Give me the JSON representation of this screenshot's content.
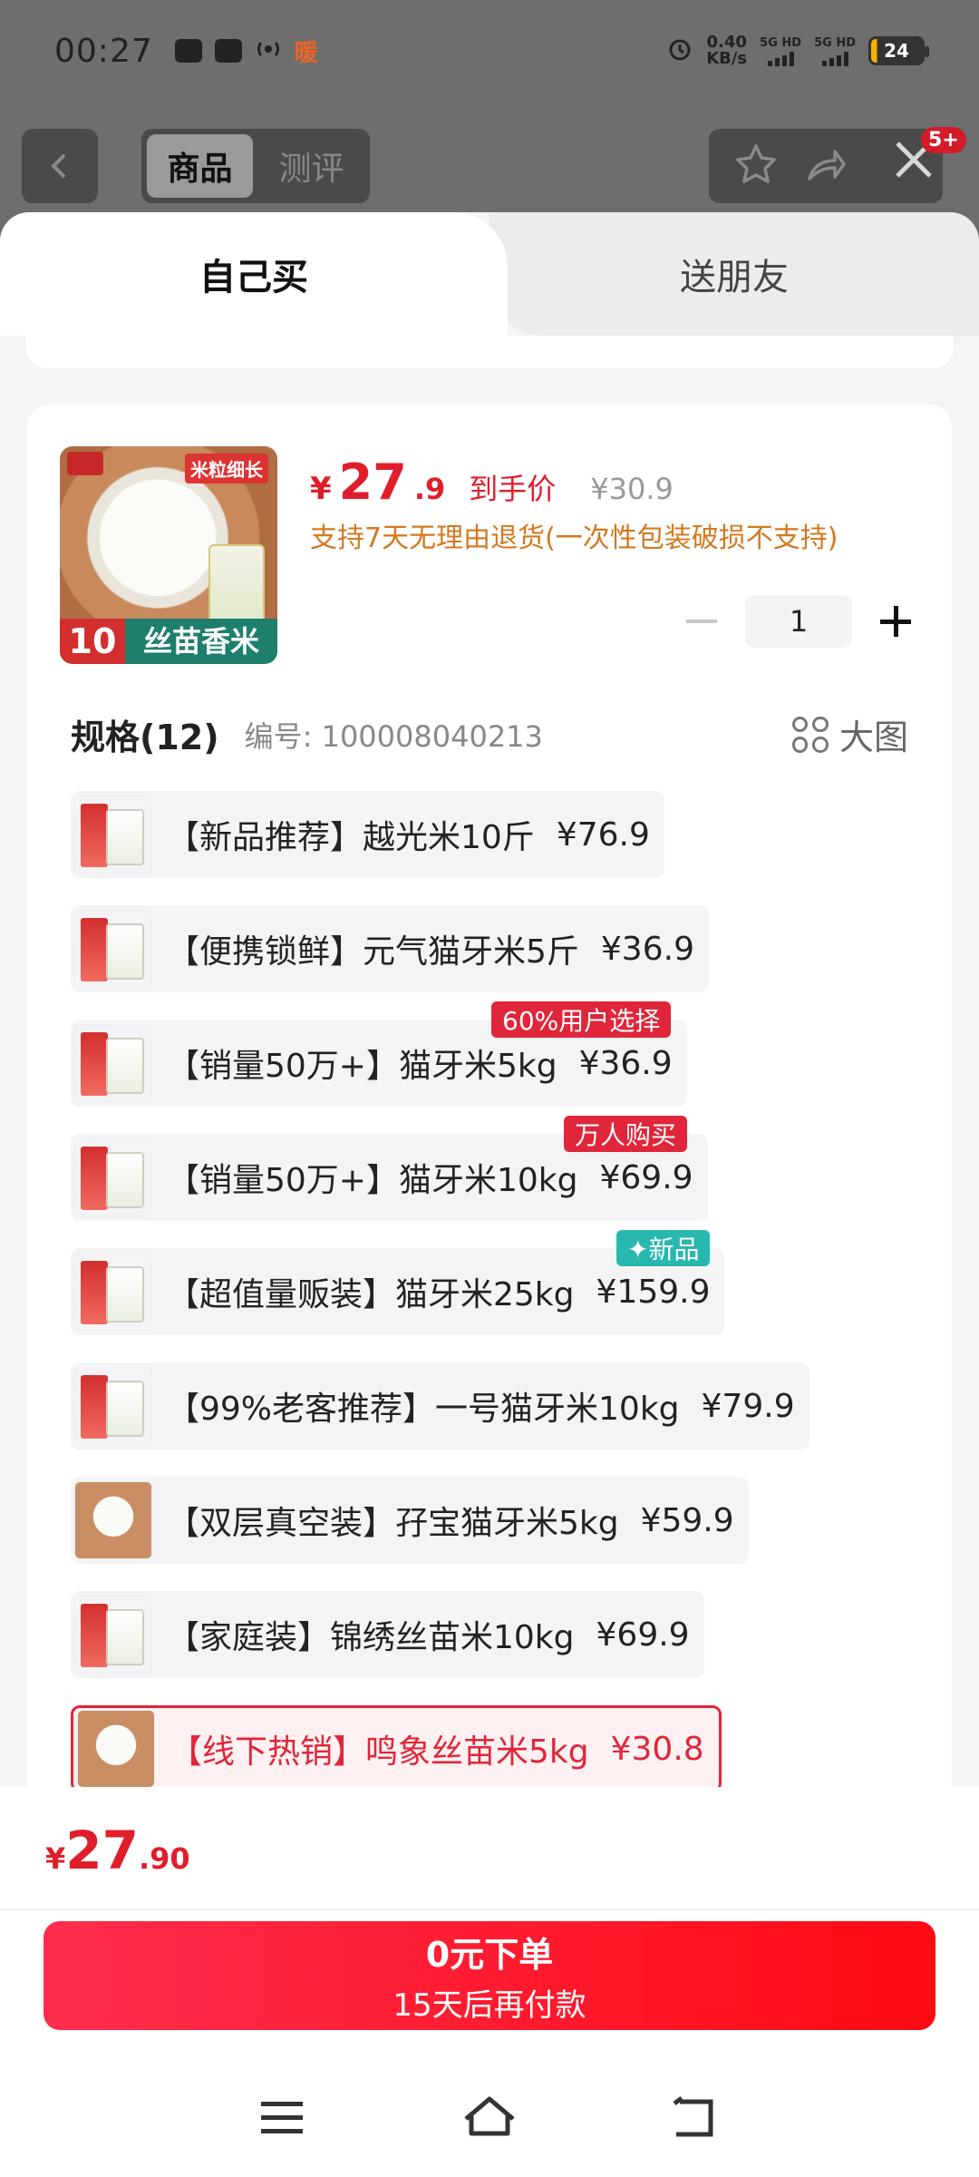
{
  "status_bar": {
    "time": "00:27",
    "indicator": "暖",
    "net_speed": "0.40",
    "net_unit": "KB/s",
    "signal1": "5G HD",
    "signal2": "5G HD",
    "battery": "24"
  },
  "top_nav": {
    "tab_product": "商品",
    "tab_review": "测评",
    "badge": "5+"
  },
  "purchase_tabs": {
    "self": "自己买",
    "gift": "送朋友"
  },
  "product": {
    "image_tag": "米粒细长",
    "image_weight": "10斤",
    "image_name": "丝苗香米",
    "price_symbol": "¥",
    "price_int": "27",
    "price_dec": ".9",
    "price_label": "到手价",
    "original_price": "¥30.9",
    "returns_note": "支持7天无理由退货(一次性包装破损不支持)",
    "quantity": "1"
  },
  "spec": {
    "title": "规格(12)",
    "sku": "编号: 100008040213",
    "big_image": "大图"
  },
  "options": [
    {
      "label": "【新品推荐】越光米10斤",
      "price": "¥76.9"
    },
    {
      "label": "【便携锁鲜】元气猫牙米5斤",
      "price": "¥36.9"
    },
    {
      "label": "【销量50万+】猫牙米5kg",
      "price": "¥36.9",
      "tag": "60%用户选择"
    },
    {
      "label": "【销量50万+】猫牙米10kg",
      "price": "¥69.9",
      "tag": "万人购买"
    },
    {
      "label": "【超值量贩装】猫牙米25kg",
      "price": "¥159.9",
      "tag": "✦新品"
    },
    {
      "label": "【99%老客推荐】一号猫牙米10kg",
      "price": "¥79.9"
    },
    {
      "label": "【双层真空装】孖宝猫牙米5kg",
      "price": "¥59.9"
    },
    {
      "label": "【家庭装】锦绣丝苗米10kg",
      "price": "¥69.9"
    },
    {
      "label": "【线下热销】鸣象丝苗米5kg",
      "price": "¥30.8",
      "selected": true
    }
  ],
  "footer": {
    "price_symbol": "¥",
    "price_int": "27",
    "price_dec": ".90",
    "cta_line1": "0元下单",
    "cta_line2": "15天后再付款"
  },
  "colors": {
    "accent": "#e01e2b",
    "returns": "#d4781f",
    "tag_teal": "#28b8b0"
  },
  "icons": [
    "back-icon",
    "star-icon",
    "share-icon",
    "close-icon",
    "grid-icon",
    "minus-icon",
    "plus-icon",
    "menu-icon",
    "home-icon",
    "back-nav-icon"
  ]
}
